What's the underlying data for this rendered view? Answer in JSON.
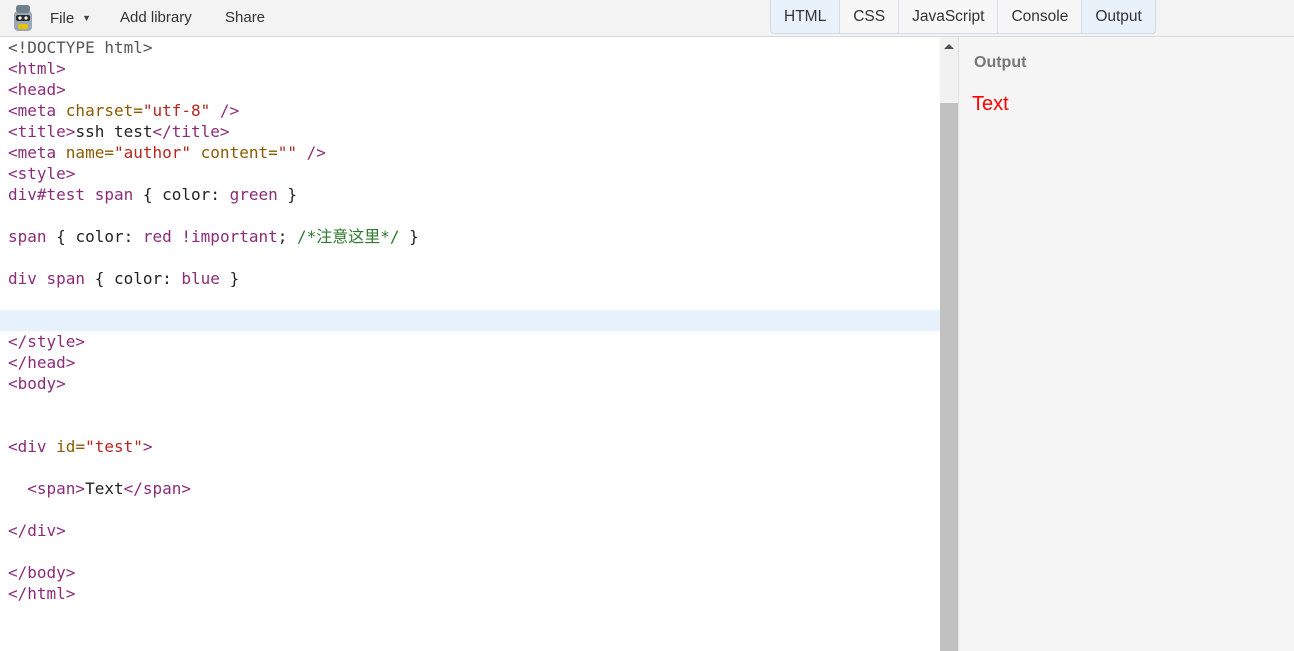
{
  "menu": {
    "file": "File",
    "add_library": "Add library",
    "share": "Share"
  },
  "tabs": [
    {
      "label": "HTML",
      "active": true
    },
    {
      "label": "CSS",
      "active": false
    },
    {
      "label": "JavaScript",
      "active": false
    },
    {
      "label": "Console",
      "active": false
    },
    {
      "label": "Output",
      "active": true
    }
  ],
  "editor": {
    "lines": [
      {
        "tokens": [
          [
            "doc",
            "<!DOCTYPE html>"
          ]
        ]
      },
      {
        "tokens": [
          [
            "tag",
            "<html>"
          ]
        ]
      },
      {
        "tokens": [
          [
            "tag",
            "<head>"
          ]
        ]
      },
      {
        "tokens": [
          [
            "tag",
            "<meta "
          ],
          [
            "attr",
            "charset="
          ],
          [
            "str",
            "\"utf-8\""
          ],
          [
            "tag",
            " />"
          ]
        ]
      },
      {
        "tokens": [
          [
            "tag",
            "<title>"
          ],
          [
            "text",
            "ssh test"
          ],
          [
            "tag",
            "</title>"
          ]
        ]
      },
      {
        "tokens": [
          [
            "tag",
            "<meta "
          ],
          [
            "attr",
            "name="
          ],
          [
            "str",
            "\"author\""
          ],
          [
            "attr",
            " content="
          ],
          [
            "str",
            "\"\""
          ],
          [
            "tag",
            " />"
          ]
        ]
      },
      {
        "tokens": [
          [
            "tag",
            "<style>"
          ]
        ]
      },
      {
        "tokens": [
          [
            "sel",
            "div#test span"
          ],
          [
            "punc",
            " { "
          ],
          [
            "prop",
            "color"
          ],
          [
            "punc",
            ": "
          ],
          [
            "val",
            "green"
          ],
          [
            "punc",
            " }"
          ]
        ]
      },
      {
        "tokens": []
      },
      {
        "tokens": [
          [
            "sel",
            "span"
          ],
          [
            "punc",
            " { "
          ],
          [
            "prop",
            "color"
          ],
          [
            "punc",
            ": "
          ],
          [
            "val",
            "red !important"
          ],
          [
            "punc",
            "; "
          ],
          [
            "cmt",
            "/*注意这里*/"
          ],
          [
            "punc",
            " }"
          ]
        ]
      },
      {
        "tokens": []
      },
      {
        "tokens": [
          [
            "sel",
            "div span"
          ],
          [
            "punc",
            " { "
          ],
          [
            "prop",
            "color"
          ],
          [
            "punc",
            ": "
          ],
          [
            "val",
            "blue"
          ],
          [
            "punc",
            " }"
          ]
        ]
      },
      {
        "tokens": []
      },
      {
        "tokens": []
      },
      {
        "tokens": [
          [
            "tag",
            "</style>"
          ]
        ]
      },
      {
        "tokens": [
          [
            "tag",
            "</head>"
          ]
        ]
      },
      {
        "tokens": [
          [
            "tag",
            "<body>"
          ]
        ]
      },
      {
        "tokens": []
      },
      {
        "tokens": []
      },
      {
        "tokens": [
          [
            "tag",
            "<div "
          ],
          [
            "attr",
            "id="
          ],
          [
            "str",
            "\"test\""
          ],
          [
            "tag",
            ">"
          ]
        ]
      },
      {
        "tokens": []
      },
      {
        "tokens": [
          [
            "text",
            "  "
          ],
          [
            "tag",
            "<span>"
          ],
          [
            "text",
            "Text"
          ],
          [
            "tag",
            "</span>"
          ]
        ]
      },
      {
        "tokens": []
      },
      {
        "tokens": [
          [
            "tag",
            "</div>"
          ]
        ]
      },
      {
        "tokens": []
      },
      {
        "tokens": [
          [
            "tag",
            "</body>"
          ]
        ]
      },
      {
        "tokens": [
          [
            "tag",
            "</html>"
          ]
        ]
      }
    ]
  },
  "output": {
    "title": "Output",
    "rendered_text": "Text",
    "rendered_color": "#ff0000"
  }
}
